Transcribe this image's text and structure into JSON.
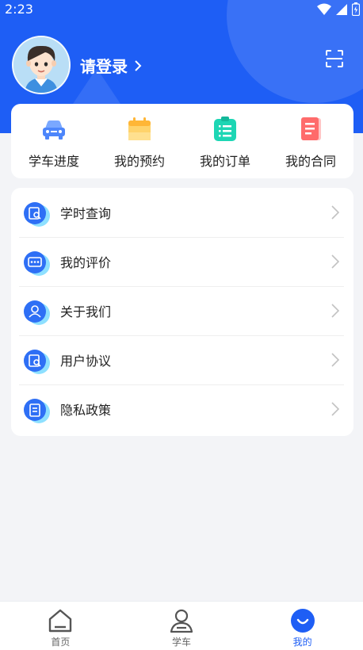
{
  "status_bar": {
    "time": "2:23"
  },
  "header": {
    "login_label": "请登录",
    "colors": {
      "header_bg": "#1e5ef5"
    },
    "icons": {
      "avatar": "avatar-boy",
      "scan": "scan-icon",
      "chevron": "chevron-right-icon"
    }
  },
  "quick_actions": {
    "items": [
      {
        "label": "学车进度",
        "icon": "car-icon"
      },
      {
        "label": "我的预约",
        "icon": "calendar-icon"
      },
      {
        "label": "我的订单",
        "icon": "clipboard-list-icon"
      },
      {
        "label": "我的合同",
        "icon": "contract-document-icon"
      }
    ]
  },
  "menu": {
    "items": [
      {
        "label": "学时查询",
        "icon": "hours-search-icon"
      },
      {
        "label": "我的评价",
        "icon": "comment-icon"
      },
      {
        "label": "关于我们",
        "icon": "user-icon"
      },
      {
        "label": "用户协议",
        "icon": "agreement-icon"
      },
      {
        "label": "隐私政策",
        "icon": "privacy-document-icon"
      }
    ]
  },
  "tabbar": {
    "items": [
      {
        "label": "首页",
        "icon": "home-icon",
        "active": false
      },
      {
        "label": "学车",
        "icon": "learner-icon",
        "active": false
      },
      {
        "label": "我的",
        "icon": "profile-smile-icon",
        "active": true
      }
    ]
  }
}
